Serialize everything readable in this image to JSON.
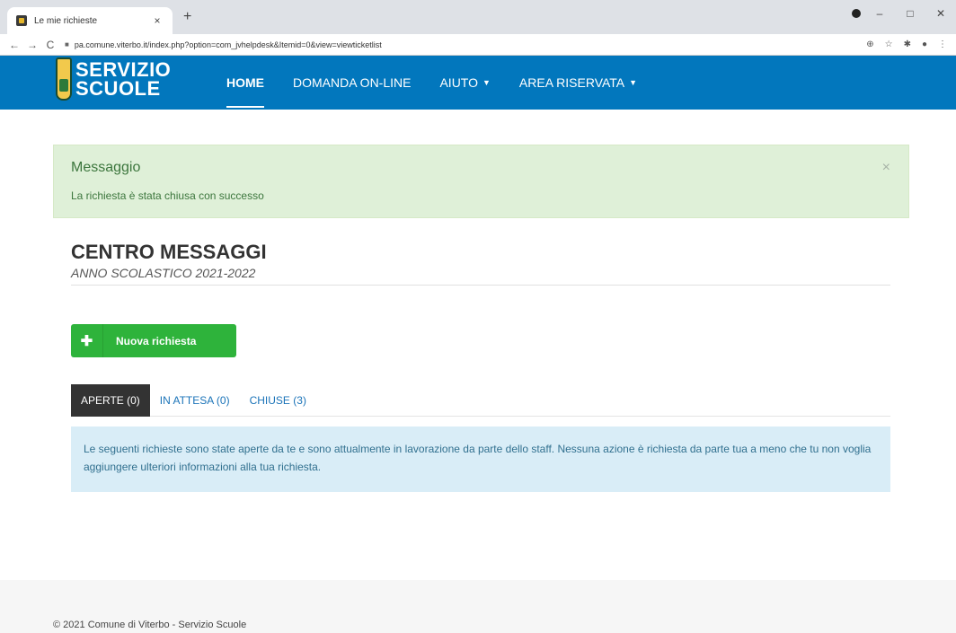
{
  "browser": {
    "tab_title": "Le mie richieste",
    "tab_close": "×",
    "new_tab": "+",
    "url": "pa.comune.viterbo.it/index.php?option=com_jvhelpdesk&Itemid=0&view=viewticketlist",
    "back": "←",
    "forward": "→",
    "reload": "C",
    "window_controls": [
      "–",
      "□",
      "✕"
    ],
    "toolbar_icons": [
      "⊕",
      "☆",
      "✱",
      "●",
      "⋮"
    ]
  },
  "site": {
    "logo_line1": "SERVIZIO",
    "logo_line2": "SCUOLE",
    "nav": [
      {
        "label": "HOME",
        "active": true
      },
      {
        "label": "DOMANDA ON-LINE",
        "active": false
      },
      {
        "label": "AIUTO",
        "dropdown": true
      },
      {
        "label": "AREA RISERVATA",
        "dropdown": true
      }
    ],
    "caret": "▼"
  },
  "alert": {
    "heading": "Messaggio",
    "text": "La richiesta è stata chiusa con successo",
    "close": "×"
  },
  "page": {
    "title": "CENTRO MESSAGGI",
    "subtitle": "ANNO SCOLASTICO 2021-2022"
  },
  "new_request": {
    "icon": "✚",
    "label": "Nuova richiesta"
  },
  "tabs": [
    {
      "label": "APERTE (0)",
      "active": true
    },
    {
      "label": "IN ATTESA (0)",
      "active": false
    },
    {
      "label": "CHIUSE (3)",
      "active": false
    }
  ],
  "info_text": "Le seguenti richieste sono state aperte da te e sono attualmente in lavorazione da parte dello staff. Nessuna azione è richiesta da parte tua a meno che tu non voglia aggiungere ulteriori informazioni alla tua richiesta.",
  "footer": "© 2021 Comune di Viterbo - Servizio Scuole",
  "colors": {
    "header": "#0277bd",
    "success_alert": "#dff0d8",
    "success_button": "#2eb33b",
    "info_panel": "#d9edf7",
    "active_tab": "#333333"
  }
}
